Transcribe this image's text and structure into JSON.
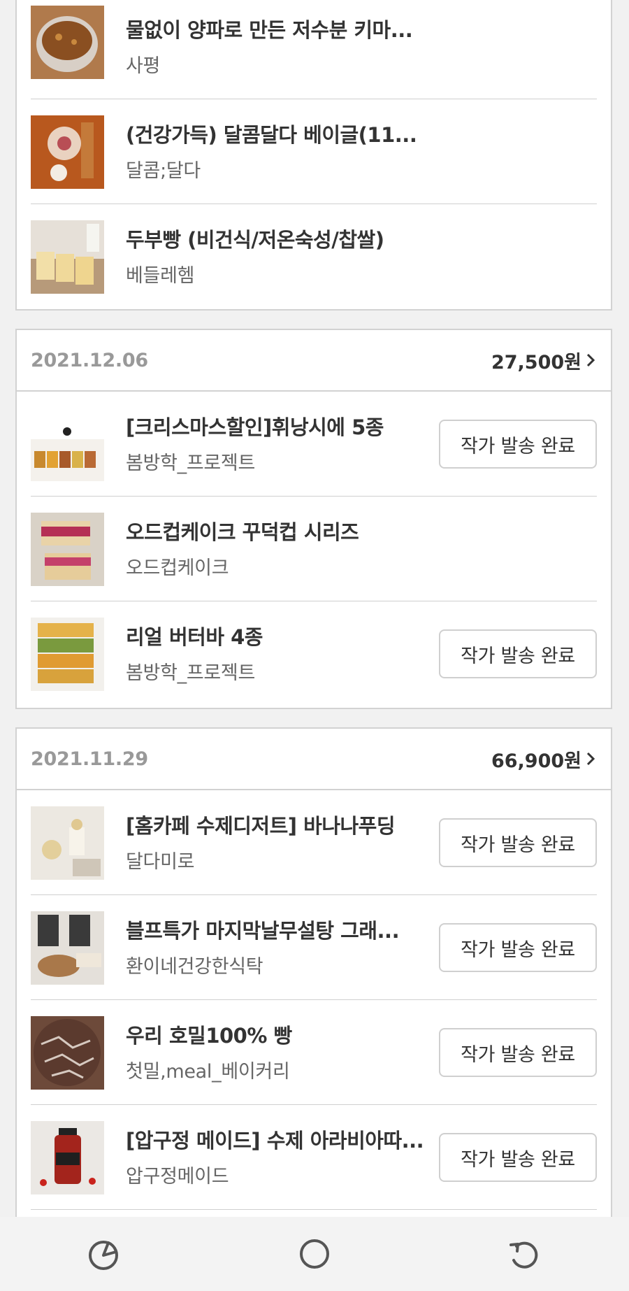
{
  "orders": [
    {
      "date": "",
      "total": "",
      "items": [
        {
          "title": "물없이 양파로 만든 저수분 키마...",
          "seller": "사평",
          "status": ""
        },
        {
          "title": "(건강가득) 달콤달다 베이글(11...",
          "seller": "달콤;달다",
          "status": ""
        },
        {
          "title": "두부빵 (비건식/저온숙성/찹쌀)",
          "seller": "베들레헴",
          "status": ""
        }
      ]
    },
    {
      "date": "2021.12.06",
      "total": "27,500원",
      "items": [
        {
          "title": "[크리스마스할인]휘낭시에 5종",
          "seller": "봄방학_프로젝트",
          "status": "작가 발송 완료"
        },
        {
          "title": "오드컵케이크 꾸덕컵 시리즈",
          "seller": "오드컵케이크",
          "status": ""
        },
        {
          "title": "리얼 버터바 4종",
          "seller": "봄방학_프로젝트",
          "status": "작가 발송 완료"
        }
      ]
    },
    {
      "date": "2021.11.29",
      "total": "66,900원",
      "items": [
        {
          "title": "[홈카페 수제디저트] 바나나푸딩",
          "seller": "달다미로",
          "status": "작가 발송 완료"
        },
        {
          "title": "블프특가 마지막날무설탕 그래...",
          "seller": "환이네건강한식탁",
          "status": "작가 발송 완료"
        },
        {
          "title": "우리 호밀100% 빵",
          "seller": "첫밀,meal_베이커리",
          "status": "작가 발송 완료"
        },
        {
          "title": "[압구정 메이드] 수제 아라비아따...",
          "seller": "압구정메이드",
          "status": "작가 발송 완료"
        }
      ]
    }
  ],
  "icons": {
    "chevron": "chevron-right-icon",
    "nav_left": "recent-apps-icon",
    "nav_center": "home-icon",
    "nav_right": "back-icon"
  },
  "colors": {
    "background": "#f1f1f1",
    "card_border": "#d2d2d2",
    "date_text": "#999999",
    "title_text": "#333333",
    "seller_text": "#666666"
  }
}
